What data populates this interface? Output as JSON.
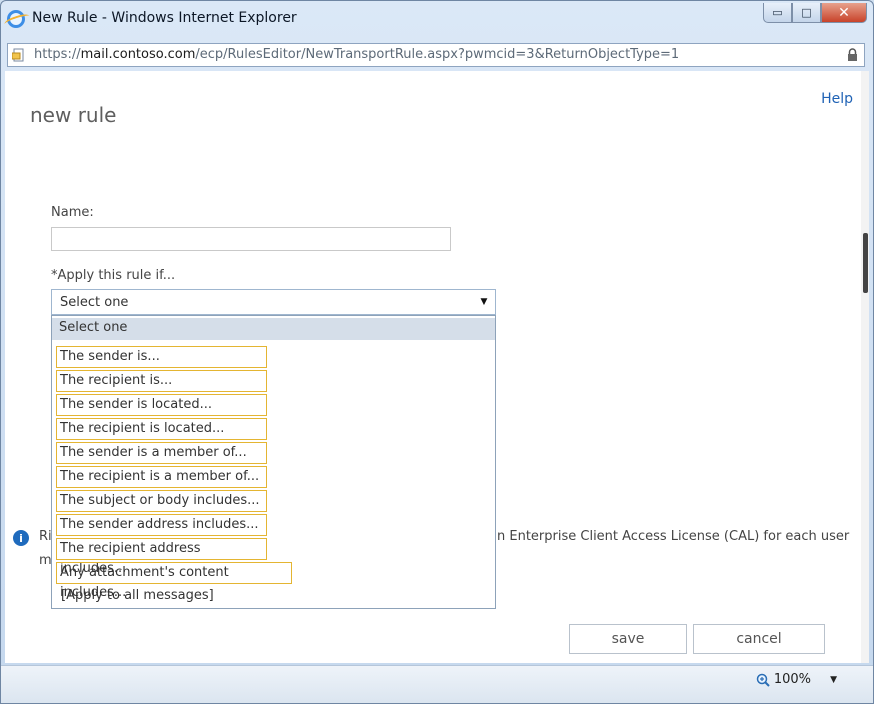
{
  "window": {
    "title": "New Rule - Windows Internet Explorer",
    "minimize_symbol": "▭",
    "maximize_symbol": "□",
    "close_symbol": "✕"
  },
  "address": {
    "scheme": "https://",
    "host": "mail.contoso.com",
    "path": "/ecp/RulesEditor/NewTransportRule.aspx?pwmcid=3&ReturnObjectType=1"
  },
  "page": {
    "help": "Help",
    "title": "new rule",
    "name_label": "Name:",
    "name_value": "",
    "apply_label": "*Apply this rule if...",
    "select_value": "Select one"
  },
  "dropdown": {
    "options": [
      "Select one",
      "The sender is...",
      "The recipient is...",
      "The sender is located...",
      "The recipient is located...",
      "The sender is a member of...",
      "The recipient is a member of...",
      "The subject or body includes...",
      "The sender address includes...",
      "The recipient address includes...",
      "Any attachment's content includes...",
      "[Apply to all messages]"
    ]
  },
  "info": {
    "icon": "i",
    "left_fragment": "Ri",
    "left_fragment2": "m",
    "text": "n Enterprise Client Access License (CAL) for each user"
  },
  "buttons": {
    "save": "save",
    "cancel": "cancel"
  },
  "status": {
    "zoom": "100%",
    "zoom_caret": "▼"
  },
  "colors": {
    "highlight_border": "#e4b532",
    "selected_option_bg": "#d5dee9",
    "link": "#1f62b5"
  }
}
